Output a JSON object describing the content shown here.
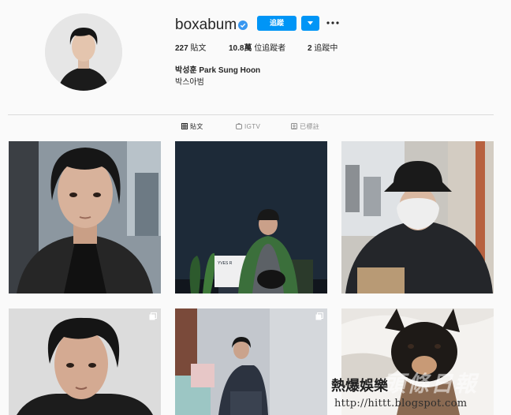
{
  "profile": {
    "username": "boxabum",
    "follow_label": "追蹤",
    "posts": {
      "count": "227",
      "label": "貼文"
    },
    "followers": {
      "count": "10.8萬",
      "label": "位追蹤者"
    },
    "following": {
      "count": "2",
      "label": "追蹤中"
    },
    "full_name": "박성훈 Park Sung Hoon",
    "bio": "박스아범"
  },
  "tabs": [
    {
      "label": "貼文",
      "icon": "grid-icon",
      "active": true
    },
    {
      "label": "IGTV",
      "icon": "igtv-icon",
      "active": false
    },
    {
      "label": "已標註",
      "icon": "tagged-icon",
      "active": false
    }
  ],
  "posts": [
    {
      "alt": "portrait-dark-hair-suit",
      "multi": false
    },
    {
      "alt": "man-with-dog-navy-wall",
      "multi": false,
      "sign_text": "YVES R"
    },
    {
      "alt": "man-bucket-hat-mask-hoodie",
      "multi": false
    },
    {
      "alt": "portrait-close-up",
      "multi": true
    },
    {
      "alt": "man-seated-studio",
      "multi": true
    },
    {
      "alt": "french-bulldog-in-bed",
      "multi": false
    }
  ],
  "watermark": {
    "line1": "熱爆娛樂",
    "line2": "頭條日報",
    "url": "http://hittt.blogspot.com"
  },
  "colors": {
    "accent": "#0095f6",
    "background": "#fafafa",
    "text": "#262626",
    "muted": "#8e8e8e"
  }
}
